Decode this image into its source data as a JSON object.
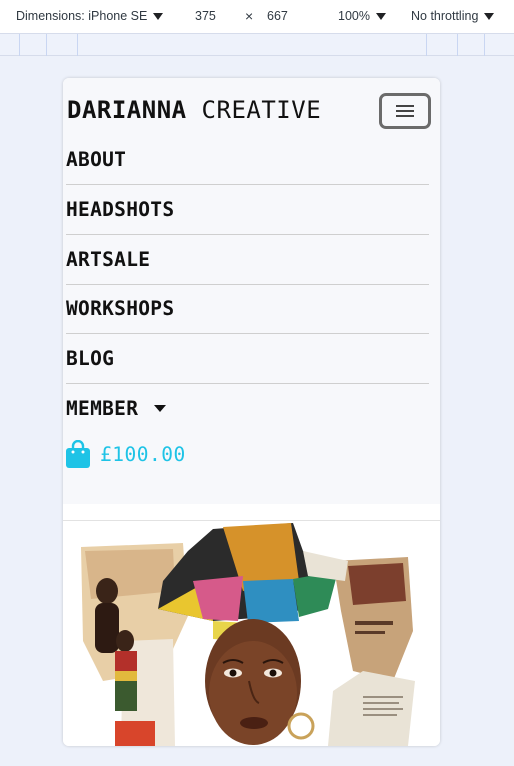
{
  "devtools": {
    "dimensions_label": "Dimensions: iPhone SE",
    "width": "375",
    "times": "×",
    "height": "667",
    "zoom": "100%",
    "throttling": "No throttling"
  },
  "site": {
    "brand_bold": "DARIANNA",
    "brand_light": "CREATIVE"
  },
  "nav": {
    "items": [
      {
        "label": "ABOUT"
      },
      {
        "label": "HEADSHOTS"
      },
      {
        "label": "ARTSALE"
      },
      {
        "label": "WORKSHOPS"
      },
      {
        "label": "BLOG"
      },
      {
        "label": "MEMBER"
      }
    ]
  },
  "cart": {
    "total": "£100.00"
  },
  "colors": {
    "accent": "#1ec3e6",
    "text": "#111111",
    "header_bg": "#f7f8fb",
    "page_bg": "#edf1fa"
  },
  "icons": {
    "menu": "hamburger-icon",
    "cart": "shopping-bag-icon",
    "member_dropdown": "caret-down-icon"
  }
}
